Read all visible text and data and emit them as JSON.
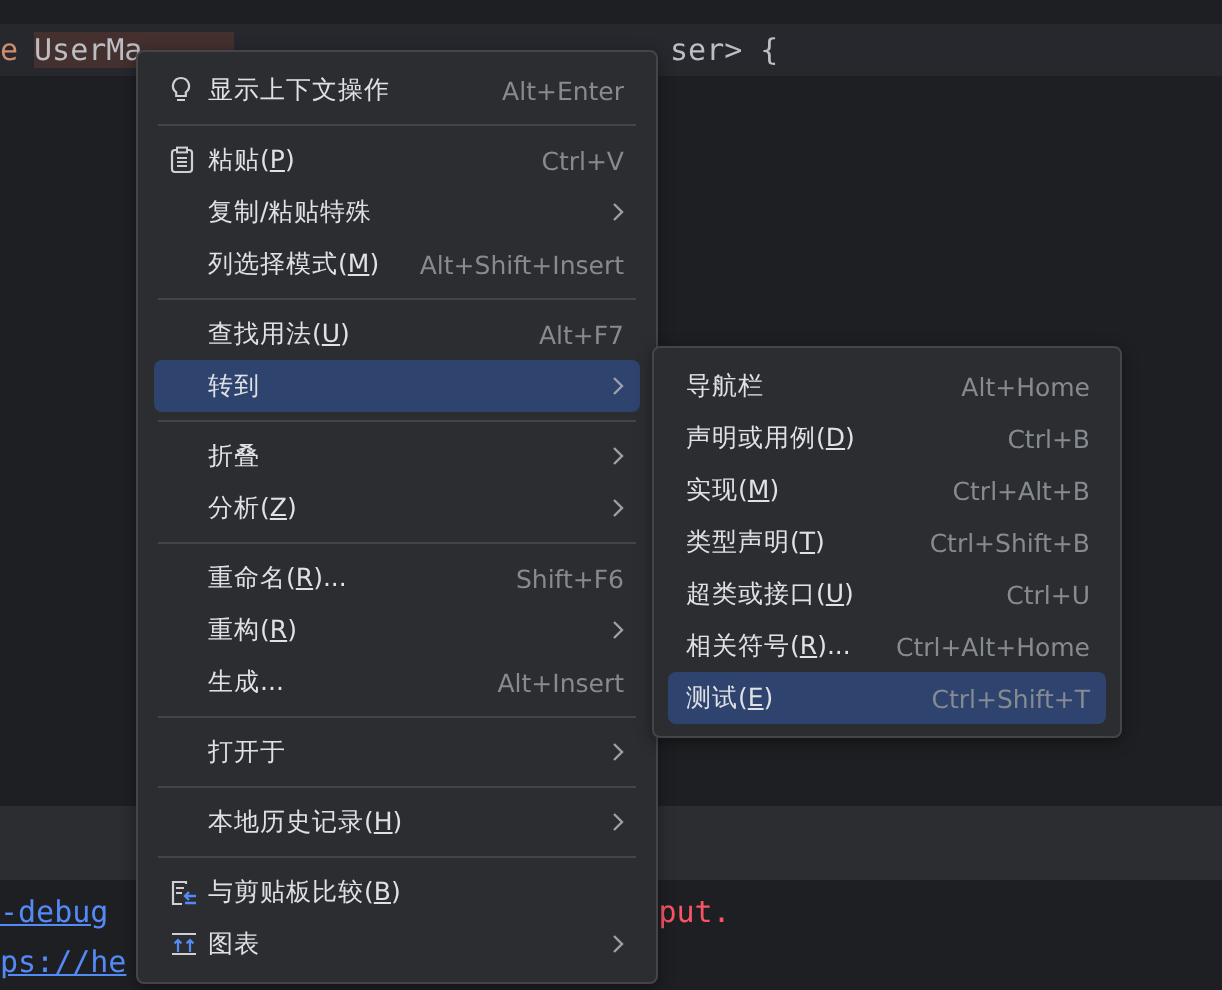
{
  "editor": {
    "code_line": {
      "keyword": "e",
      "identifier": "UserMa",
      "rest": "ser> {"
    }
  },
  "console": {
    "lines": [
      {
        "link": "-debug ",
        "error": "put."
      },
      {
        "link": "ps://he"
      }
    ]
  },
  "context_menu": {
    "groups": [
      [
        {
          "label": "显示上下文操作",
          "kind": "bulb",
          "shortcut": "Alt+Enter",
          "submenu": false,
          "selected": false
        }
      ],
      [
        {
          "label": "粘贴(P)",
          "kind": "clipboard",
          "shortcut": "Ctrl+V",
          "submenu": false,
          "selected": false
        },
        {
          "label": "复制/粘贴特殊",
          "submenu": true,
          "selected": false
        },
        {
          "label": "列选择模式(M)",
          "shortcut": "Alt+Shift+Insert",
          "submenu": false,
          "selected": false
        }
      ],
      [
        {
          "label": "查找用法(U)",
          "shortcut": "Alt+F7",
          "submenu": false,
          "selected": false
        },
        {
          "label": "转到",
          "submenu": true,
          "selected": true
        }
      ],
      [
        {
          "label": "折叠",
          "submenu": true,
          "selected": false
        },
        {
          "label": "分析(Z)",
          "submenu": true,
          "selected": false
        }
      ],
      [
        {
          "label": "重命名(R)...",
          "shortcut": "Shift+F6",
          "submenu": false,
          "selected": false
        },
        {
          "label": "重构(R)",
          "submenu": true,
          "selected": false
        },
        {
          "label": "生成...",
          "shortcut": "Alt+Insert",
          "submenu": false,
          "selected": false
        }
      ],
      [
        {
          "label": "打开于",
          "submenu": true,
          "selected": false
        }
      ],
      [
        {
          "label": "本地历史记录(H)",
          "submenu": true,
          "selected": false
        }
      ],
      [
        {
          "label": "与剪贴板比较(B)",
          "kind": "compare",
          "submenu": false,
          "selected": false
        },
        {
          "label": "图表",
          "kind": "diagram",
          "submenu": true,
          "selected": false
        }
      ]
    ]
  },
  "submenu": {
    "items": [
      {
        "label": "导航栏",
        "shortcut": "Alt+Home",
        "selected": false
      },
      {
        "label": "声明或用例(D)",
        "shortcut": "Ctrl+B",
        "selected": false
      },
      {
        "label": "实现(M)",
        "shortcut": "Ctrl+Alt+B",
        "selected": false
      },
      {
        "label": "类型声明(T)",
        "shortcut": "Ctrl+Shift+B",
        "selected": false
      },
      {
        "label": "超类或接口(U)",
        "shortcut": "Ctrl+U",
        "selected": false
      },
      {
        "label": "相关符号(R)...",
        "shortcut": "Ctrl+Alt+Home",
        "selected": false
      },
      {
        "label": "测试(E)",
        "shortcut": "Ctrl+Shift+T",
        "selected": true
      }
    ]
  }
}
